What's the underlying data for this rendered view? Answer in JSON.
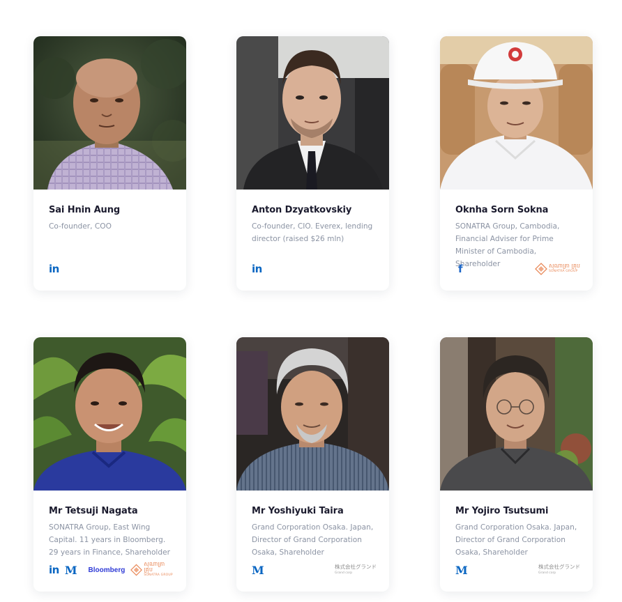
{
  "team": [
    {
      "name": "Sai Hnin Aung",
      "role": "Co-founder, COO",
      "links": [
        "linkedin-icon"
      ]
    },
    {
      "name": "Anton Dzyatkovskiy",
      "role": "Co-founder, CIO. Everex, lending director (raised $26 mln)",
      "links": [
        "linkedin-icon"
      ]
    },
    {
      "name": "Oknha Sorn Sokna",
      "role": "SONATRA Group, Cambodia, Financial Adviser for Prime Minister of Cambodia, Shareholder",
      "links": [
        "facebook-icon",
        "sonatra-group-logo"
      ]
    },
    {
      "name": "Mr Tetsuji Nagata",
      "role": "SONATRA Group, East Wing Capital. 11 years in Bloomberg. 29 years in Finance, Shareholder",
      "links": [
        "linkedin-icon",
        "medium-icon",
        "bloomberg-logo",
        "sonatra-group-logo"
      ]
    },
    {
      "name": "Mr Yoshiyuki Taira",
      "role": "Grand Corporation Osaka. Japan, Director of Grand Corporation Osaka, Shareholder",
      "links": [
        "medium-icon",
        "grand-corp-logo"
      ]
    },
    {
      "name": "Mr Yojiro Tsutsumi",
      "role": "Grand Corporation Osaka. Japan, Director of Grand Corporation Osaka, Shareholder",
      "links": [
        "medium-icon",
        "grand-corp-logo"
      ]
    }
  ],
  "icons": {
    "linkedin": "in",
    "medium": "M",
    "facebook": "f",
    "bloomberg": "Bloomberg",
    "sonatra_khmer": "សុណាត្រា គ្រុប",
    "sonatra_english": "SONATRA GROUP",
    "grand_jp": "株式会社グランド",
    "grand_en": "Grand corp"
  },
  "colors": {
    "linkedin": "#0a66c2",
    "bloomberg": "#2f3bd6",
    "sonatra": "#e98a5a",
    "name_text": "#1b1b2e",
    "role_text": "#8b93a3"
  }
}
